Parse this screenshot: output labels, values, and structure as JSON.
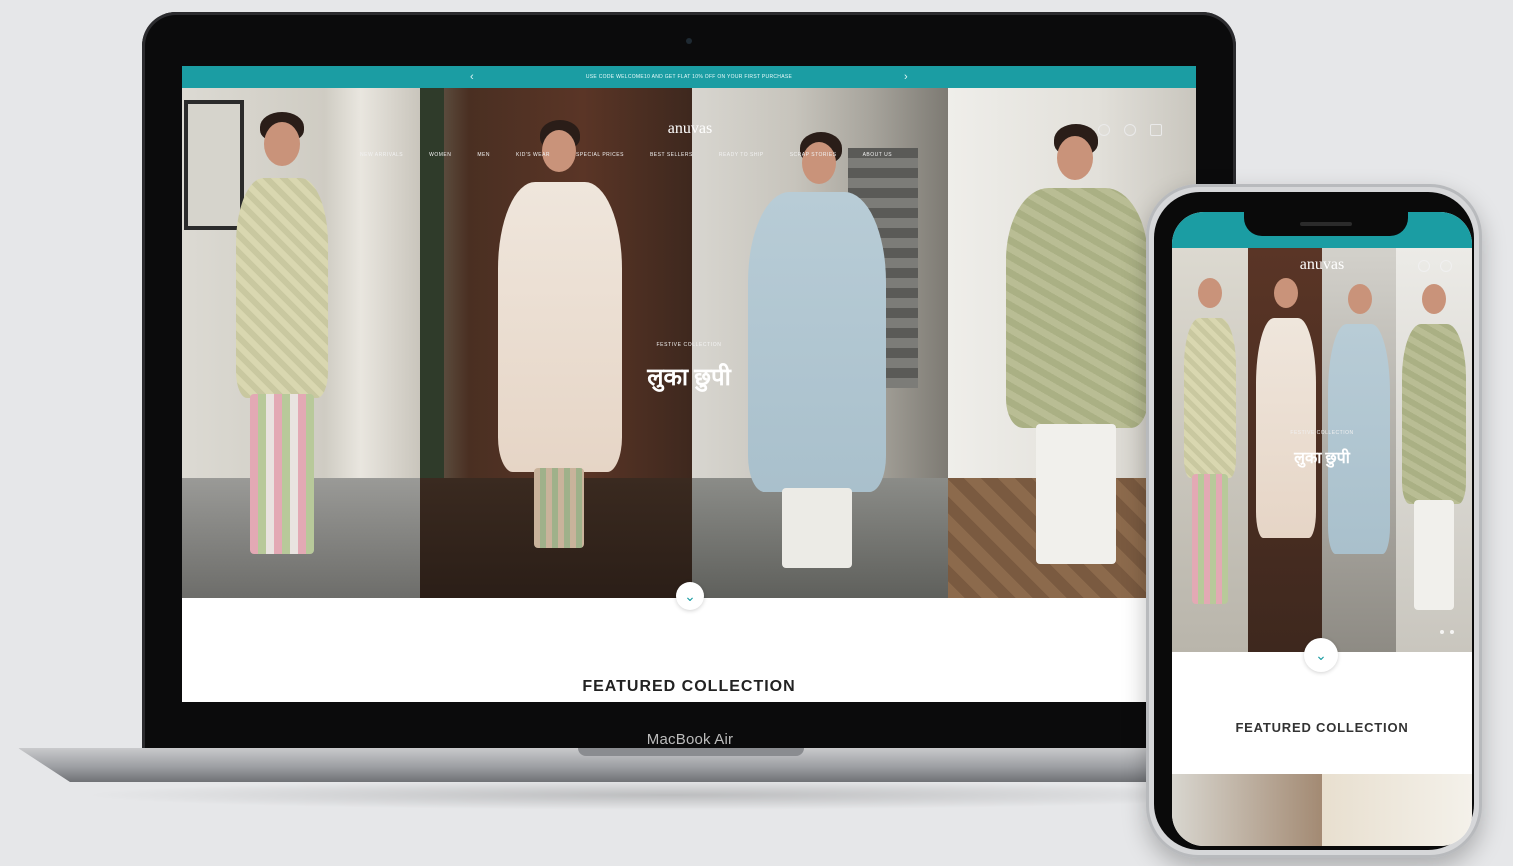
{
  "laptop": {
    "device_label": "MacBook Air",
    "announcement": {
      "text": "USE CODE WELCOME10 AND GET FLAT 10% OFF ON YOUR FIRST PURCHASE",
      "prev_arrow": "‹",
      "next_arrow": "›"
    },
    "brand": "anuvas",
    "nav_items": [
      "NEW ARRIVALS",
      "WOMEN",
      "MEN",
      "KID'S WEAR",
      "SPECIAL PRICES",
      "BEST SELLERS",
      "READY TO SHIP",
      "SCRAP STORIES",
      "ABOUT US"
    ],
    "hero": {
      "subtitle": "FESTIVE COLLECTION",
      "title": "लुका छुपी"
    },
    "scroll_icon": "⌄",
    "featured_title": "FEATURED COLLECTION"
  },
  "phone": {
    "brand": "anuvas",
    "hero": {
      "subtitle": "FESTIVE COLLECTION",
      "title": "लुका छुपी"
    },
    "scroll_icon": "⌄",
    "featured_title": "FEATURED COLLECTION"
  },
  "colors": {
    "accent": "#1b9da3",
    "background": "#e6e7e9"
  },
  "icons": [
    "user-icon",
    "search-icon",
    "cart-icon",
    "chevron-down-icon",
    "chevron-left-icon",
    "chevron-right-icon"
  ]
}
